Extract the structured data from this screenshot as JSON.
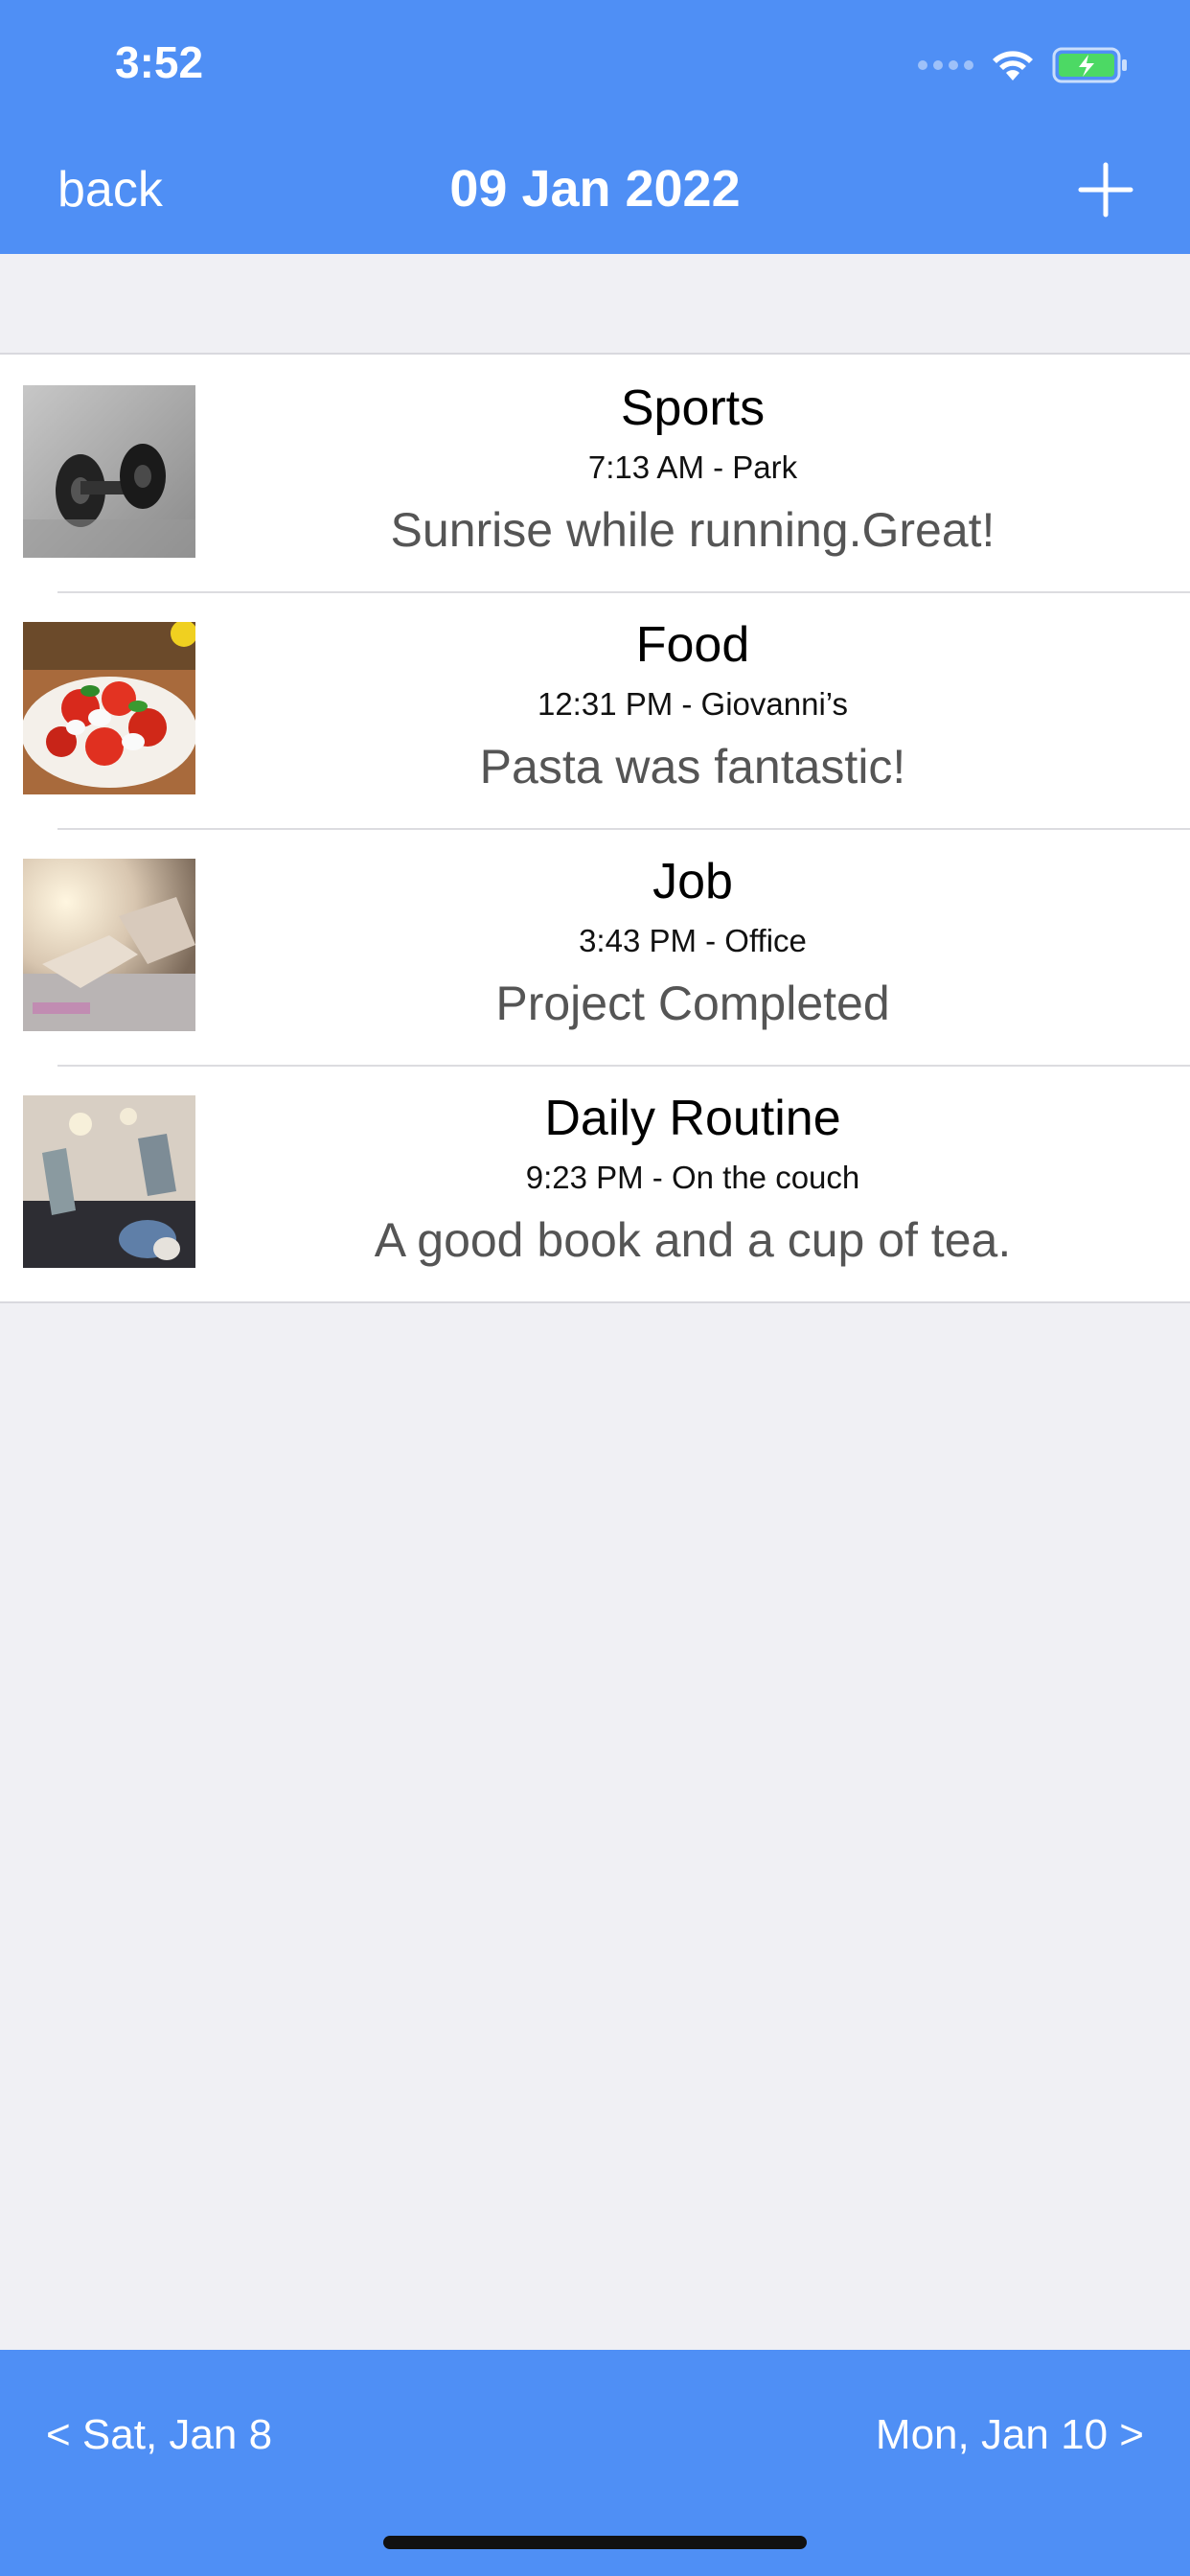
{
  "status_bar": {
    "time": "3:52"
  },
  "nav": {
    "back_label": "back",
    "title": "09 Jan 2022"
  },
  "entries": [
    {
      "title": "Sports",
      "subtitle": "7:13 AM - Park",
      "note": "Sunrise while running.Great!",
      "image": "dumbbells-photo"
    },
    {
      "title": "Food",
      "subtitle": "12:31 PM - Giovanni’s",
      "note": "Pasta was fantastic!",
      "image": "caprese-salad-photo"
    },
    {
      "title": "Job",
      "subtitle": "3:43 PM - Office",
      "note": "Project Completed",
      "image": "office-desk-photo"
    },
    {
      "title": "Daily Routine",
      "subtitle": "9:23 PM - On the couch",
      "note": "A good book and a cup of tea.",
      "image": "cozy-socks-photo"
    }
  ],
  "footer": {
    "prev_label": "< Sat, Jan 8",
    "next_label": "Mon, Jan 10 >"
  },
  "colors": {
    "accent": "#4f8ff5",
    "background": "#f0f0f4",
    "battery": "#4cd964"
  }
}
